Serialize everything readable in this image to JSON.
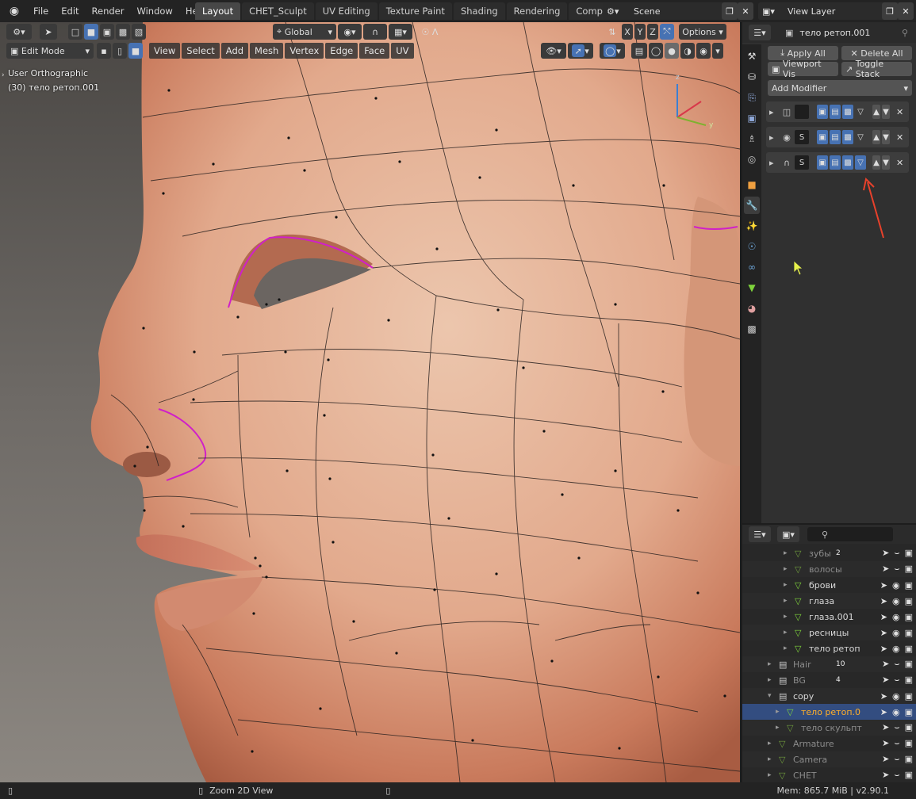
{
  "topbar": {
    "menus": [
      "File",
      "Edit",
      "Render",
      "Window",
      "Help"
    ],
    "workspace_tabs": [
      "Layout",
      "CHET_Sculpt",
      "UV Editing",
      "Texture Paint",
      "Shading",
      "Rendering",
      "Compositing",
      "+"
    ],
    "active_tab": "Layout",
    "scene_label": "Scene",
    "view_layer_label": "View Layer"
  },
  "viewport": {
    "transform_orientation": "Global",
    "axes": [
      "X",
      "Y",
      "Z"
    ],
    "options_label": "Options",
    "mode": "Edit Mode",
    "menus": [
      "View",
      "Select",
      "Add",
      "Mesh",
      "Vertex",
      "Edge",
      "Face",
      "UV"
    ],
    "view_name": "User Orthographic",
    "object_info": "(30) тело ретоп.001",
    "gizmo_x": "x",
    "gizmo_y": "y",
    "gizmo_z": "z"
  },
  "properties": {
    "object_name": "тело ретоп.001",
    "apply_all": "Apply All",
    "delete_all": "Delete All",
    "viewport_vis": "Viewport Vis",
    "toggle_stack": "Toggle Stack",
    "add_modifier": "Add Modifier",
    "modifiers": [
      {
        "icon": "mirror-modifier-icon",
        "name": ""
      },
      {
        "icon": "subsurf-modifier-icon",
        "name": "S"
      },
      {
        "icon": "shrinkwrap-modifier-icon",
        "name": "S"
      }
    ]
  },
  "outliner": {
    "search_placeholder": "",
    "rows": [
      {
        "name": "зубы",
        "indent": 4,
        "dim": true,
        "badge": "2"
      },
      {
        "name": "волосы",
        "indent": 4,
        "dim": true
      },
      {
        "name": "брови",
        "indent": 4,
        "dim": false
      },
      {
        "name": "глаза",
        "indent": 4,
        "dim": false
      },
      {
        "name": "глаза.001",
        "indent": 4,
        "dim": false
      },
      {
        "name": "ресницы",
        "indent": 4,
        "dim": false
      },
      {
        "name": "тело ретоп",
        "indent": 4,
        "dim": false
      },
      {
        "name": "Hair",
        "indent": 2,
        "dim": true,
        "badge": "10"
      },
      {
        "name": "BG",
        "indent": 2,
        "dim": true,
        "badge": "4"
      },
      {
        "name": "copy",
        "indent": 2,
        "dim": false
      },
      {
        "name": "тело ретоп.0",
        "indent": 3,
        "dim": false,
        "selected": true
      },
      {
        "name": "тело скульпт",
        "indent": 3,
        "dim": true
      },
      {
        "name": "Armature",
        "indent": 2,
        "dim": true
      },
      {
        "name": "Camera",
        "indent": 2,
        "dim": true
      },
      {
        "name": "CHET",
        "indent": 2,
        "dim": true
      }
    ]
  },
  "status": {
    "hint": "Zoom 2D View",
    "memory": "Mem: 865.7 MiB | v2.90.1"
  },
  "colors": {
    "accent": "#4772b3",
    "active_object": "#ffaf29",
    "mesh_icon": "#7ed33b",
    "annotation_arrow": "#e8412b",
    "skin": "#e6b49a"
  }
}
